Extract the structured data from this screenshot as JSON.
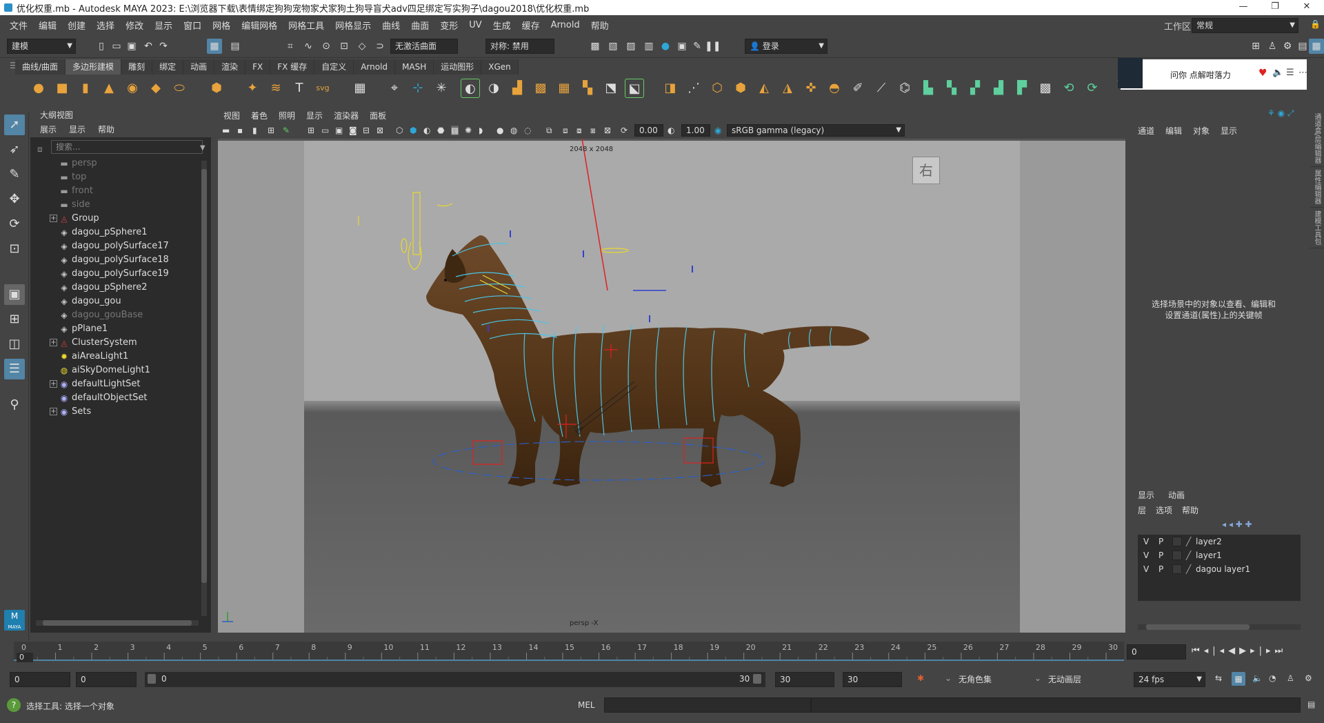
{
  "window": {
    "title": "优化权重.mb - Autodesk MAYA 2023: E:\\浏览器下载\\表情绑定狗狗宠物家犬家狗土狗导盲犬adv四足绑定写实狗子\\dagou2018\\优化权重.mb"
  },
  "menubar": {
    "items": [
      "文件",
      "编辑",
      "创建",
      "选择",
      "修改",
      "显示",
      "窗口",
      "网格",
      "编辑网格",
      "网格工具",
      "网格显示",
      "曲线",
      "曲面",
      "变形",
      "UV",
      "生成",
      "缓存",
      "Arnold",
      "帮助"
    ],
    "workspace_label": "工作区:",
    "workspace_value": "常规"
  },
  "toolbar": {
    "mode": "建模",
    "live_surface": "无激活曲面",
    "symmetry": "对称: 禁用",
    "login": "登录"
  },
  "shelf": {
    "tabs": [
      "曲线/曲面",
      "多边形建模",
      "雕刻",
      "绑定",
      "动画",
      "渲染",
      "FX",
      "FX 缓存",
      "自定义",
      "Arnold",
      "MASH",
      "运动图形",
      "XGen"
    ],
    "active_tab": "多边形建模"
  },
  "notification": {
    "text": "问你 点解咁落力"
  },
  "outliner": {
    "title": "大纲视图",
    "menu": [
      "展示",
      "显示",
      "帮助"
    ],
    "search_placeholder": "搜索...",
    "items": [
      {
        "label": "persp",
        "icon": "camera-icon",
        "dim": true,
        "expandable": false
      },
      {
        "label": "top",
        "icon": "camera-icon",
        "dim": true,
        "expandable": false
      },
      {
        "label": "front",
        "icon": "camera-icon",
        "dim": true,
        "expandable": false
      },
      {
        "label": "side",
        "icon": "camera-icon",
        "dim": true,
        "expandable": false
      },
      {
        "label": "Group",
        "icon": "group-icon",
        "dim": false,
        "expandable": true
      },
      {
        "label": "dagou_pSphere1",
        "icon": "mesh-icon",
        "dim": false,
        "expandable": false
      },
      {
        "label": "dagou_polySurface17",
        "icon": "mesh-icon",
        "dim": false,
        "expandable": false
      },
      {
        "label": "dagou_polySurface18",
        "icon": "mesh-icon",
        "dim": false,
        "expandable": false
      },
      {
        "label": "dagou_polySurface19",
        "icon": "mesh-icon",
        "dim": false,
        "expandable": false
      },
      {
        "label": "dagou_pSphere2",
        "icon": "mesh-icon",
        "dim": false,
        "expandable": false
      },
      {
        "label": "dagou_gou",
        "icon": "mesh-icon",
        "dim": false,
        "expandable": false
      },
      {
        "label": "dagou_gouBase",
        "icon": "mesh-icon",
        "dim": true,
        "expandable": false
      },
      {
        "label": "pPlane1",
        "icon": "mesh-icon",
        "dim": false,
        "expandable": false
      },
      {
        "label": "ClusterSystem",
        "icon": "group-icon",
        "dim": false,
        "expandable": true
      },
      {
        "label": "aiAreaLight1",
        "icon": "light-icon",
        "dim": false,
        "expandable": false
      },
      {
        "label": "aiSkyDomeLight1",
        "icon": "skydome-icon",
        "dim": false,
        "expandable": false
      },
      {
        "label": "defaultLightSet",
        "icon": "set-icon",
        "dim": false,
        "expandable": true
      },
      {
        "label": "defaultObjectSet",
        "icon": "set-icon",
        "dim": false,
        "expandable": false
      },
      {
        "label": "Sets",
        "icon": "set-icon",
        "dim": false,
        "expandable": true
      }
    ]
  },
  "viewport": {
    "menu": [
      "视图",
      "着色",
      "照明",
      "显示",
      "渲染器",
      "面板"
    ],
    "exposure": "0.00",
    "gamma": "1.00",
    "color_space": "sRGB gamma (legacy)",
    "resolution": "2048 x 2048",
    "view_cube_label": "右",
    "camera_label": "persp -X"
  },
  "channelbox": {
    "menu": [
      "通道",
      "编辑",
      "对象",
      "显示"
    ],
    "hint": "选择场景中的对象以查看、编辑和设置通道(属性)上的关键帧",
    "side_tabs": [
      "通道盒/层编辑器",
      "属性编辑器",
      "建模工具包"
    ],
    "layer_tabs": [
      "显示",
      "动画"
    ],
    "layer_menu": [
      "层",
      "选项",
      "帮助"
    ],
    "layers": [
      {
        "v": "V",
        "p": "P",
        "name": "layer2"
      },
      {
        "v": "V",
        "p": "P",
        "name": "layer1"
      },
      {
        "v": "V",
        "p": "P",
        "name": "dagou layer1"
      }
    ]
  },
  "timeline": {
    "ticks": [
      "0",
      "1",
      "2",
      "3",
      "4",
      "5",
      "6",
      "7",
      "8",
      "9",
      "10",
      "11",
      "12",
      "13",
      "14",
      "15",
      "16",
      "17",
      "18",
      "19",
      "20",
      "21",
      "22",
      "23",
      "24",
      "25",
      "26",
      "27",
      "28",
      "29",
      "30"
    ],
    "current_frame": "0",
    "current_display": "0"
  },
  "range": {
    "start": "0",
    "anim_start": "0",
    "range_start": "0",
    "range_end": "30",
    "anim_end": "30",
    "end": "30",
    "character_set": "无角色集",
    "anim_layer": "无动画层",
    "fps": "24 fps"
  },
  "commandline": {
    "status": "选择工具: 选择一个对象",
    "lang": "MEL"
  },
  "colors": {
    "accent": "#5285a6",
    "panel": "#444444",
    "field": "#2b2b2b"
  }
}
